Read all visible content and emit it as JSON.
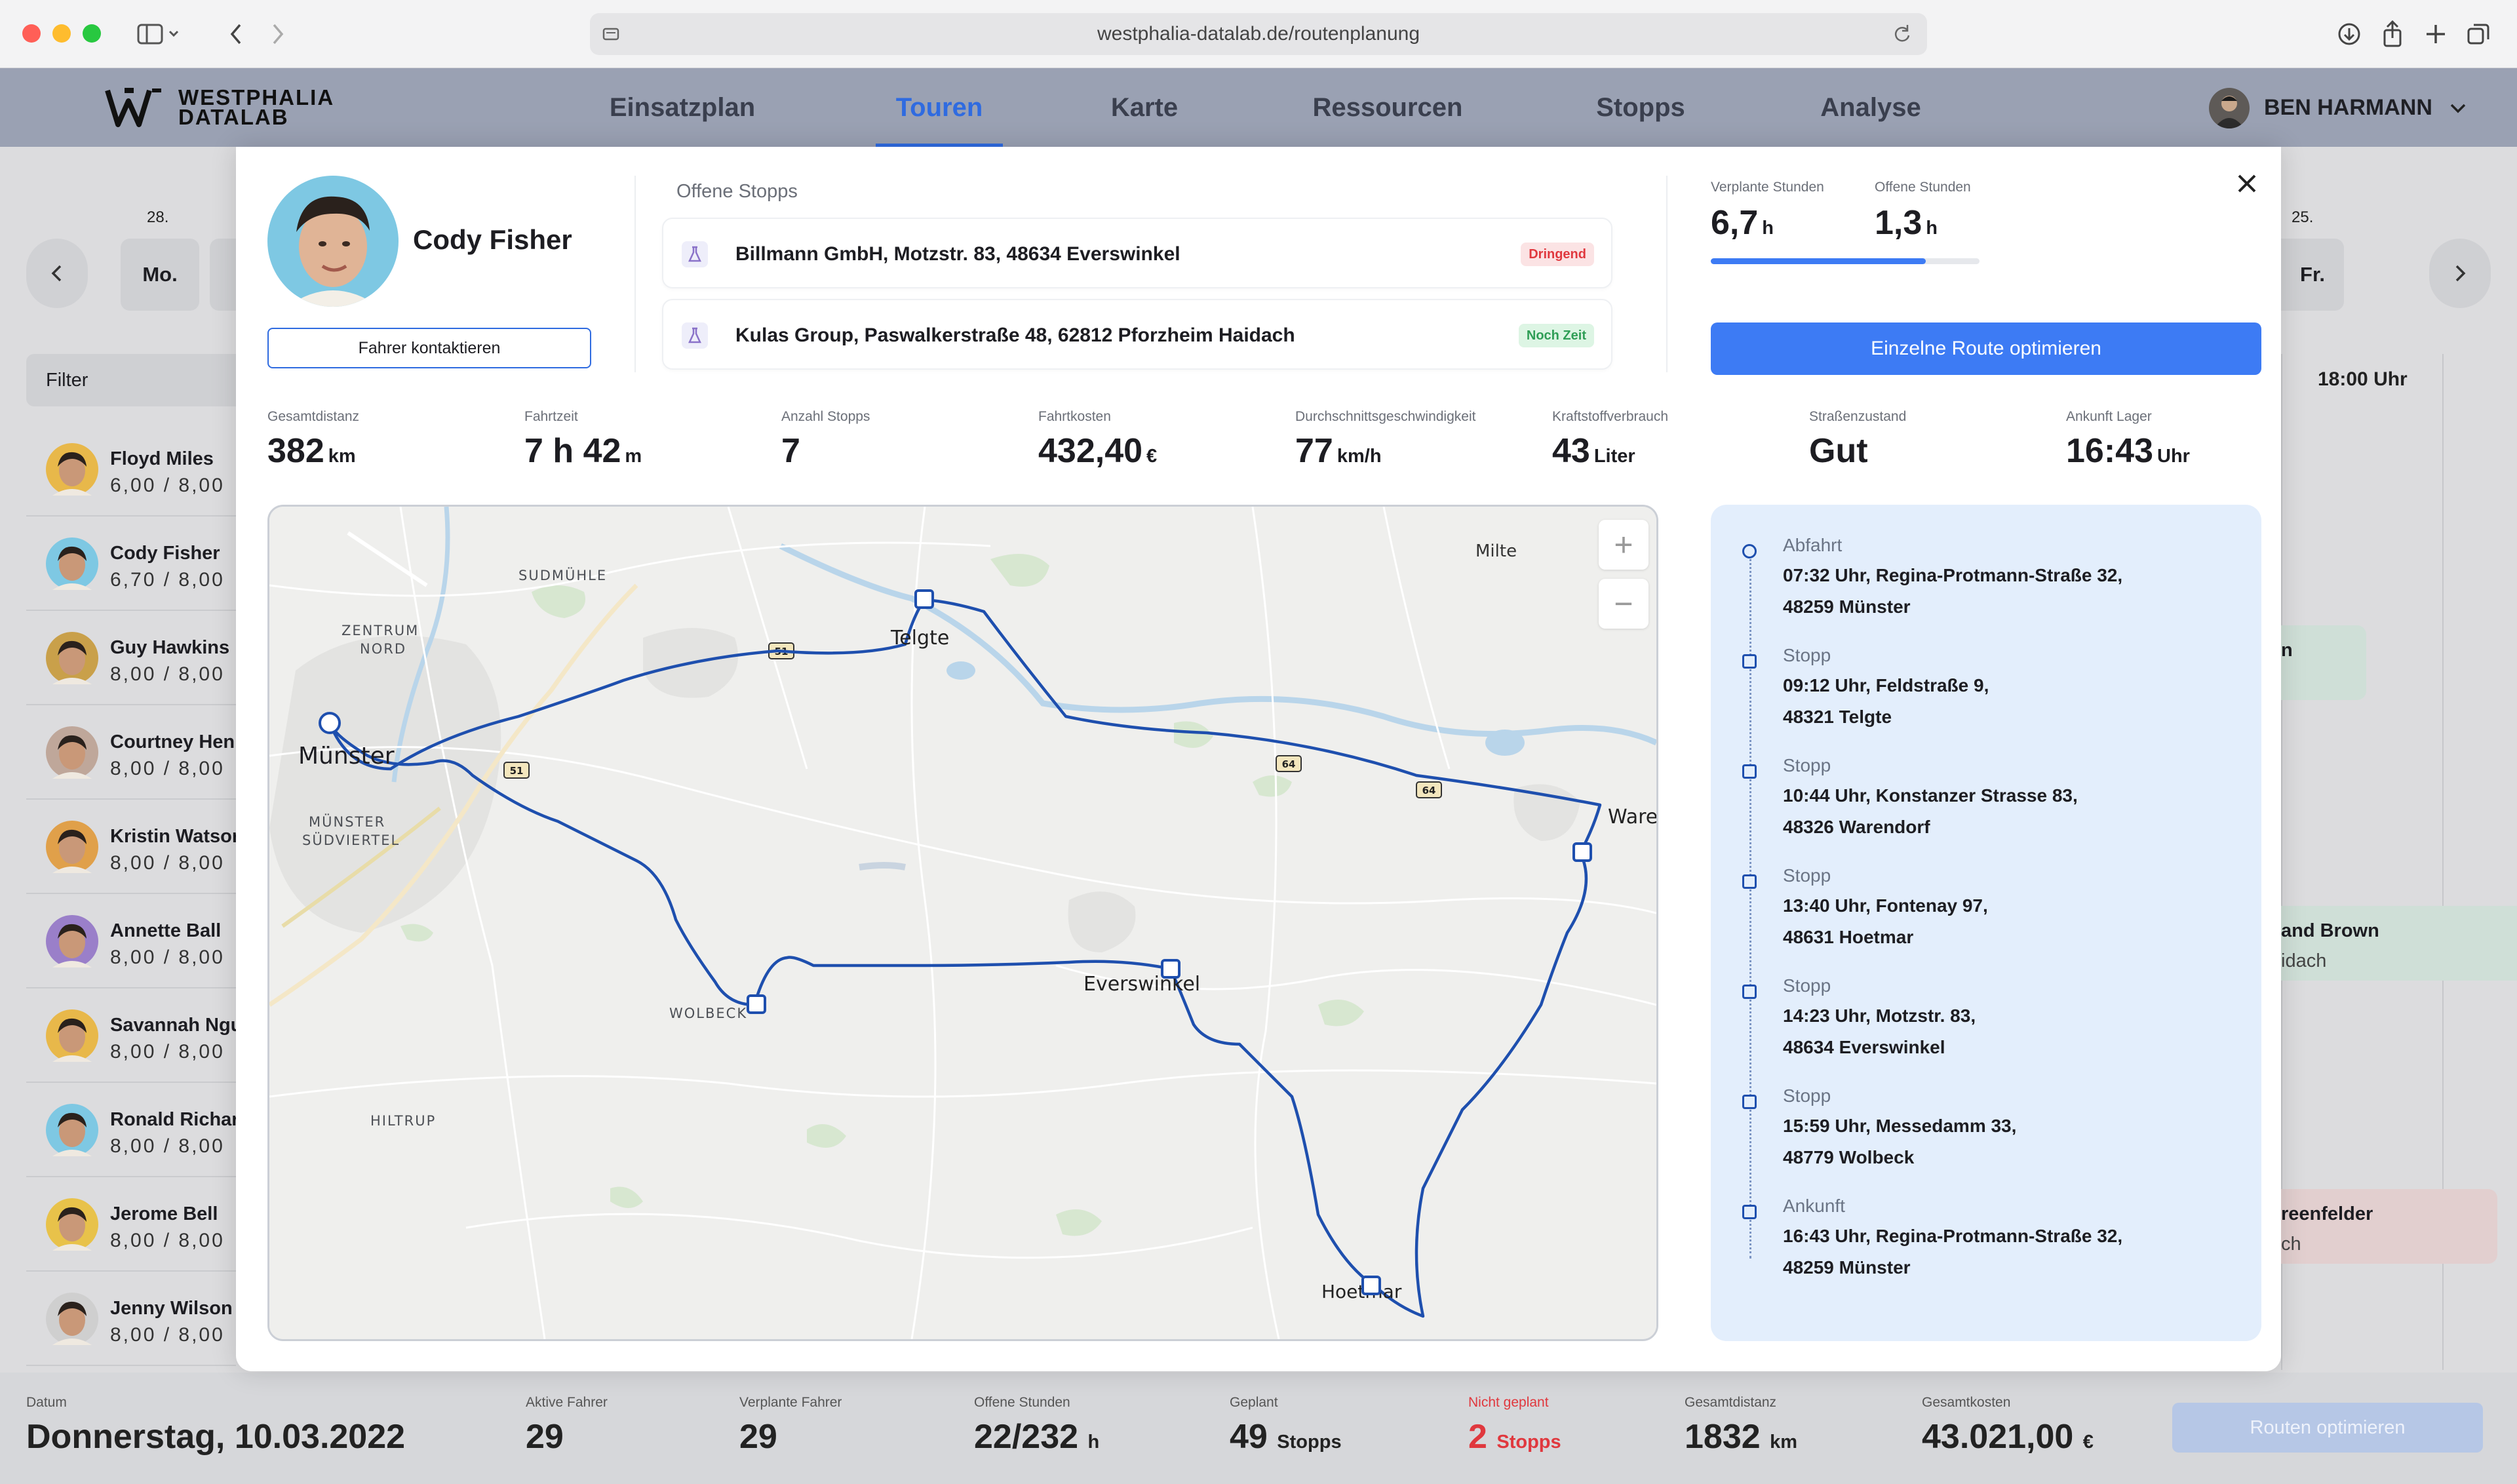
{
  "browser": {
    "url": "westphalia-datalab.de/routenplanung"
  },
  "app": {
    "logo_line1": "WESTPHALIA",
    "logo_line2": "DATALAB",
    "nav": [
      "Einsatzplan",
      "Touren",
      "Karte",
      "Ressourcen",
      "Stopps",
      "Analyse"
    ],
    "active_tab": "Touren",
    "user_name": "BEN HARMANN"
  },
  "background": {
    "days": [
      {
        "num": "28.",
        "label": "Mo."
      },
      {
        "num": "25.",
        "label": "Fr."
      }
    ],
    "filter_label": "Filter",
    "time_header": "18:00 Uhr",
    "drivers": [
      {
        "name": "Floyd Miles",
        "hours": "6,00 / 8,00"
      },
      {
        "name": "Cody Fisher",
        "hours": "6,70 / 8,00"
      },
      {
        "name": "Guy Hawkins",
        "hours": "8,00 / 8,00"
      },
      {
        "name": "Courtney Hen",
        "hours": "8,00 / 8,00"
      },
      {
        "name": "Kristin Watsor",
        "hours": "8,00 / 8,00"
      },
      {
        "name": "Annette Ball",
        "hours": "8,00 / 8,00"
      },
      {
        "name": "Savannah Ngu",
        "hours": "8,00 / 8,00"
      },
      {
        "name": "Ronald Richar",
        "hours": "8,00 / 8,00"
      },
      {
        "name": "Jerome Bell",
        "hours": "8,00 / 8,00"
      },
      {
        "name": "Jenny Wilson",
        "hours": "8,00 / 8,00"
      }
    ],
    "tour_fragments": [
      {
        "line1": "n",
        "line2": ""
      },
      {
        "line1": "and Brown",
        "line2": "idach"
      },
      {
        "line1": "reenfelder",
        "line2": "ch"
      }
    ]
  },
  "bottom_bar": {
    "date_label": "Datum",
    "date_value": "Donnerstag, 10.03.2022",
    "stats": [
      {
        "label": "Aktive Fahrer",
        "value": "29",
        "unit": ""
      },
      {
        "label": "Verplante Fahrer",
        "value": "29",
        "unit": ""
      },
      {
        "label": "Offene Stunden",
        "value": "22/232",
        "unit": "h"
      },
      {
        "label": "Geplant",
        "value": "49",
        "unit": "Stopps"
      },
      {
        "label": "Nicht geplant",
        "value": "2",
        "unit": "Stopps"
      },
      {
        "label": "Gesamtdistanz",
        "value": "1832",
        "unit": "km"
      },
      {
        "label": "Gesamtkosten",
        "value": "43.021,00",
        "unit": "€"
      }
    ],
    "optimize_all_label": "Routen optimieren"
  },
  "modal": {
    "driver_name": "Cody Fisher",
    "contact_label": "Fahrer kontaktieren",
    "open_stops_title": "Offene Stopps",
    "open_stops": [
      {
        "text": "Billmann GmbH, Motzstr. 83, 48634 Everswinkel",
        "badge": "Dringend"
      },
      {
        "text": "Kulas Group, Paswalkerstraße 48, 62812 Pforzheim Haidach",
        "badge": "Noch Zeit"
      }
    ],
    "hours": {
      "planned_label": "Verplante Stunden",
      "planned_value": "6,7",
      "open_label": "Offene Stunden",
      "open_value": "1,3",
      "unit": "h",
      "progress": 0.8
    },
    "optimize_label": "Einzelne Route optimieren",
    "stats": [
      {
        "label": "Gesamtdistanz",
        "value": "382",
        "unit": "km"
      },
      {
        "label": "Fahrtzeit",
        "value": "7 h 42",
        "unit": "m"
      },
      {
        "label": "Anzahl Stopps",
        "value": "7",
        "unit": ""
      },
      {
        "label": "Fahrtkosten",
        "value": "432,40",
        "unit": "€"
      },
      {
        "label": "Durchschnittsgeschwindigkeit",
        "value": "77",
        "unit": "km/h"
      },
      {
        "label": "Kraftstoffverbrauch",
        "value": "43",
        "unit": "Liter"
      },
      {
        "label": "Straßenzustand",
        "value": "Gut",
        "unit": ""
      },
      {
        "label": "Ankunft Lager",
        "value": "16:43",
        "unit": "Uhr"
      }
    ],
    "map": {
      "places": [
        "Münster",
        "Telgte",
        "Everswinkel",
        "Hoetmar",
        "Ware",
        "Milte",
        "WOLBECK",
        "SUDMÜHLE",
        "ZENTRUM",
        "NORD",
        "MÜNSTER",
        "SÜDVIERTEL",
        "HILTRUP"
      ],
      "road_numbers": [
        "51",
        "51",
        "64",
        "64"
      ],
      "zoom_in": "+",
      "zoom_out": "−"
    },
    "timeline": [
      {
        "type": "Abfahrt",
        "line1": "07:32 Uhr, Regina-Protmann-Straße 32,",
        "line2": "48259 Münster"
      },
      {
        "type": "Stopp",
        "line1": "09:12 Uhr, Feldstraße 9,",
        "line2": "48321 Telgte"
      },
      {
        "type": "Stopp",
        "line1": "10:44 Uhr, Konstanzer Strasse 83,",
        "line2": "48326 Warendorf"
      },
      {
        "type": "Stopp",
        "line1": "13:40 Uhr, Fontenay 97,",
        "line2": "48631 Hoetmar"
      },
      {
        "type": "Stopp",
        "line1": "14:23 Uhr, Motzstr. 83,",
        "line2": "48634 Everswinkel"
      },
      {
        "type": "Stopp",
        "line1": "15:59 Uhr, Messedamm 33,",
        "line2": "48779 Wolbeck"
      },
      {
        "type": "Ankunft",
        "line1": "16:43 Uhr, Regina-Protmann-Straße 32,",
        "line2": "48259 Münster"
      }
    ]
  },
  "colors": {
    "accent": "#3d7bf4",
    "route": "#1e4fae",
    "urgent": "#e0383e",
    "ok": "#2f9e56"
  }
}
